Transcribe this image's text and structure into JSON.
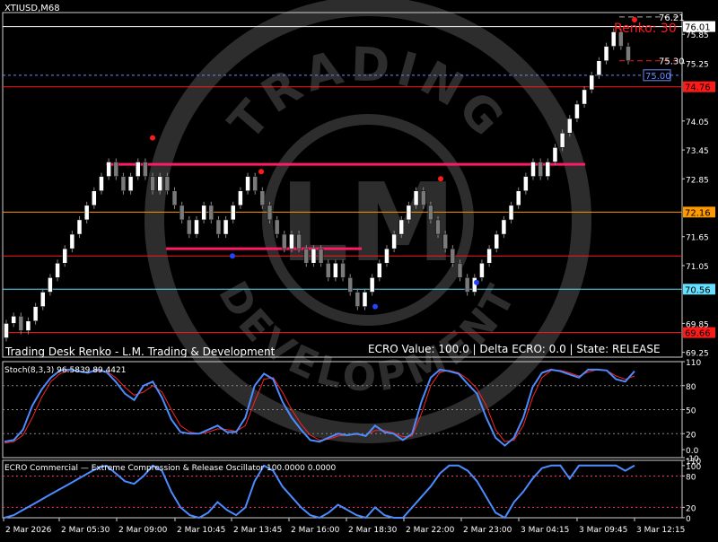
{
  "window": {
    "symbol_title": "XTIUSD,M68"
  },
  "main_chart": {
    "renko_label": "Renko: 30",
    "renko_label_color": "#ff1a1a",
    "footer_left": "Trading Desk Renko - L.M. Trading & Development",
    "footer_right": "ECRO Value: 100.0   |   Delta ECRO: 0.0   |   State: RELEASE",
    "price_tags": [
      {
        "label": "76.21",
        "price": 76.21,
        "style": "plain"
      },
      {
        "label": "76.01",
        "price": 76.01,
        "style": "box-white",
        "box_color": "#ffffff",
        "text_color": "#000000"
      },
      {
        "label": "75.85",
        "price": 75.85,
        "style": "axis"
      },
      {
        "label": "75.30",
        "price": 75.3,
        "style": "plain"
      },
      {
        "label": "75.25",
        "price": 75.25,
        "style": "axis"
      },
      {
        "label": "75.00",
        "price": 75.0,
        "style": "boxed-blue",
        "text_color": "#6a8cff"
      },
      {
        "label": "74.76",
        "price": 74.76,
        "style": "box",
        "box_color": "#ff1a1a",
        "text_color": "#000000"
      },
      {
        "label": "74.05",
        "price": 74.05,
        "style": "axis"
      },
      {
        "label": "73.45",
        "price": 73.45,
        "style": "axis"
      },
      {
        "label": "72.85",
        "price": 72.85,
        "style": "axis"
      },
      {
        "label": "72.16",
        "price": 72.16,
        "style": "box",
        "box_color": "#ff9900",
        "text_color": "#000000"
      },
      {
        "label": "71.65",
        "price": 71.65,
        "style": "axis"
      },
      {
        "label": "71.05",
        "price": 71.05,
        "style": "axis"
      },
      {
        "label": "70.56",
        "price": 70.56,
        "style": "box",
        "box_color": "#66e0ff",
        "text_color": "#000000"
      },
      {
        "label": "69.85",
        "price": 69.85,
        "style": "axis"
      },
      {
        "label": "69.66",
        "price": 69.66,
        "style": "box",
        "box_color": "#ff1a1a",
        "text_color": "#000000"
      },
      {
        "label": "69.25",
        "price": 69.25,
        "style": "axis"
      }
    ],
    "horizontal_levels": [
      {
        "price": 76.01,
        "color": "#ffffff",
        "dash": false
      },
      {
        "price": 75.0,
        "color": "#6a8cff",
        "dash": true
      },
      {
        "price": 74.76,
        "color": "#ff1a1a",
        "dash": false
      },
      {
        "price": 72.16,
        "color": "#ff9900",
        "dash": false
      },
      {
        "price": 71.25,
        "color": "#ff1a1a",
        "dash": false
      },
      {
        "price": 70.56,
        "color": "#66e0ff",
        "dash": false
      },
      {
        "price": 69.66,
        "color": "#ff1a1a",
        "dash": false
      }
    ],
    "bricks": [
      69.85,
      70.0,
      69.7,
      69.9,
      70.2,
      70.5,
      70.8,
      71.1,
      71.4,
      71.7,
      72.0,
      72.3,
      72.6,
      72.9,
      73.2,
      72.9,
      72.6,
      72.9,
      73.2,
      72.9,
      72.6,
      72.9,
      72.6,
      72.3,
      72.0,
      71.7,
      72.0,
      72.3,
      72.0,
      71.7,
      72.0,
      72.3,
      72.6,
      72.9,
      72.6,
      72.3,
      72.0,
      71.7,
      71.4,
      71.7,
      71.4,
      71.1,
      71.4,
      71.1,
      70.8,
      71.1,
      70.8,
      70.5,
      70.2,
      70.5,
      70.8,
      71.1,
      71.4,
      71.7,
      72.0,
      72.3,
      72.6,
      72.3,
      72.0,
      71.7,
      71.4,
      71.1,
      70.8,
      70.5,
      70.8,
      71.1,
      71.4,
      71.7,
      72.0,
      72.3,
      72.6,
      72.9,
      73.2,
      72.9,
      73.2,
      73.5,
      73.8,
      74.1,
      74.4,
      74.7,
      75.0,
      75.3,
      75.6,
      75.9,
      75.6,
      75.3
    ]
  },
  "stoch": {
    "title": "Stoch(8,3,3) 96.5839 89.4421",
    "axis_labels": [
      {
        "label": "110",
        "value": 110
      },
      {
        "label": "80",
        "value": 80
      },
      {
        "label": "50",
        "value": 50
      },
      {
        "label": "20",
        "value": 20
      },
      {
        "label": "0.0",
        "value": 0
      },
      {
        "label": "-10",
        "value": -10
      }
    ],
    "main_color": "#4d8cff",
    "signal_color": "#ff2222",
    "main": [
      10,
      12,
      25,
      55,
      75,
      90,
      99,
      100,
      98,
      96,
      100,
      97,
      85,
      70,
      62,
      80,
      85,
      65,
      38,
      22,
      20,
      20,
      25,
      30,
      22,
      22,
      40,
      80,
      95,
      88,
      60,
      40,
      25,
      12,
      10,
      15,
      20,
      18,
      20,
      17,
      30,
      22,
      20,
      12,
      20,
      60,
      90,
      100,
      98,
      95,
      82,
      70,
      40,
      15,
      5,
      15,
      40,
      78,
      96,
      100,
      98,
      94,
      90,
      100,
      100,
      99,
      88,
      85,
      98
    ],
    "signal": [
      8,
      10,
      18,
      40,
      65,
      85,
      95,
      99,
      98,
      97,
      98,
      98,
      90,
      78,
      68,
      72,
      80,
      72,
      50,
      30,
      22,
      20,
      22,
      26,
      25,
      23,
      30,
      60,
      88,
      90,
      72,
      50,
      32,
      18,
      12,
      13,
      17,
      18,
      19,
      18,
      24,
      24,
      21,
      16,
      17,
      45,
      80,
      97,
      99,
      96,
      88,
      76,
      55,
      25,
      10,
      12,
      30,
      65,
      90,
      99,
      99,
      96,
      92,
      97,
      100,
      99,
      92,
      88,
      92
    ]
  },
  "ecro": {
    "title": "ECRO Commercial — Extreme Compression & Release Oscillator 100.0000 0.0000",
    "axis_labels": [
      {
        "label": "110",
        "value": 110
      },
      {
        "label": "100",
        "value": 100
      },
      {
        "label": "80",
        "value": 80
      },
      {
        "label": "20",
        "value": 20
      },
      {
        "label": "0",
        "value": 0
      }
    ],
    "line_color": "#4d8cff",
    "values": [
      0,
      5,
      15,
      25,
      35,
      45,
      55,
      65,
      75,
      85,
      95,
      100,
      85,
      70,
      65,
      80,
      100,
      90,
      50,
      20,
      5,
      0,
      10,
      30,
      15,
      5,
      20,
      70,
      100,
      90,
      60,
      40,
      20,
      5,
      0,
      10,
      25,
      15,
      5,
      0,
      20,
      5,
      0,
      0,
      20,
      40,
      60,
      85,
      100,
      100,
      90,
      70,
      40,
      10,
      0,
      30,
      50,
      75,
      95,
      100,
      100,
      75,
      100,
      100,
      100,
      100,
      100,
      90,
      100
    ]
  },
  "time_axis": {
    "labels": [
      "2 Mar 2026",
      "2 Mar 05:30",
      "2 Mar 09:00",
      "2 Mar 10:45",
      "2 Mar 13:45",
      "2 Mar 16:00",
      "2 Mar 18:30",
      "2 Mar 22:00",
      "2 Mar 23:00",
      "3 Mar 04:15",
      "3 Mar 09:45",
      "3 Mar 12:15"
    ]
  },
  "watermark": {
    "top_text": "TRADING",
    "bottom_text": "DEVELOPMENT",
    "logo_text": "LM"
  }
}
